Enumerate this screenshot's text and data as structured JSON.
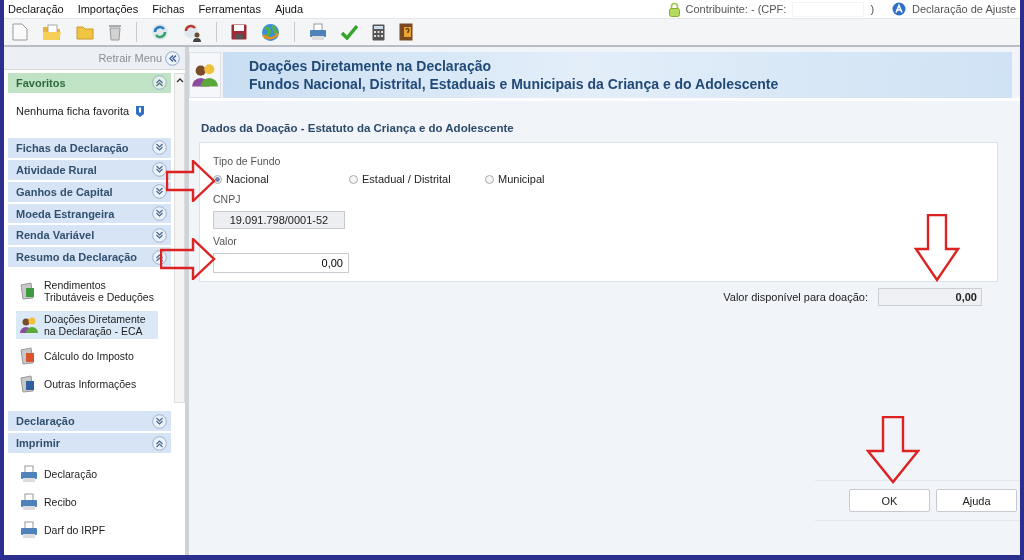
{
  "menu": [
    "Declaração",
    "Importações",
    "Fichas",
    "Ferramentas",
    "Ajuda"
  ],
  "status": {
    "taxpayer": "Contribuinte:  - (CPF:",
    "close_paren": ")",
    "declaration": "Declaração de Ajuste"
  },
  "sidebar": {
    "retract": "Retrair Menu",
    "sections": [
      {
        "title": "Favoritos",
        "kind": "favorites",
        "expanded": true,
        "empty_text": "Nenhuma ficha favorita"
      },
      {
        "title": "Fichas da Declaração",
        "kind": "group",
        "expanded": false
      },
      {
        "title": "Atividade Rural",
        "kind": "group",
        "expanded": false
      },
      {
        "title": "Ganhos de Capital",
        "kind": "group",
        "expanded": false
      },
      {
        "title": "Moeda Estrangeira",
        "kind": "group",
        "expanded": false
      },
      {
        "title": "Renda Variável",
        "kind": "group",
        "expanded": false
      },
      {
        "title": "Resumo da Declaração",
        "kind": "group",
        "expanded": true,
        "items": [
          {
            "label": "Rendimentos Tributáveis e Deduções",
            "kind": "money",
            "selected": false
          },
          {
            "label": "Doações Diretamente na Declaração - ECA",
            "kind": "people",
            "selected": true
          },
          {
            "label": "Cálculo do Imposto",
            "kind": "percent",
            "selected": false
          },
          {
            "label": "Outras Informações",
            "kind": "info",
            "selected": false
          }
        ]
      },
      {
        "title": "Declaração",
        "kind": "group",
        "expanded": false
      },
      {
        "title": "Imprimir",
        "kind": "group",
        "expanded": true,
        "items": [
          {
            "label": "Declaração",
            "kind": "printer",
            "selected": false
          },
          {
            "label": "Recibo",
            "kind": "printer",
            "selected": false
          },
          {
            "label": "Darf do IRPF",
            "kind": "printer",
            "selected": false
          }
        ]
      }
    ]
  },
  "header": {
    "title": "Doações Diretamente na Declaração",
    "subtitle": "Fundos Nacional, Distrital, Estaduais e Municipais da Criança e do Adolescente"
  },
  "form": {
    "title": "Dados da Doação - Estatuto da Criança e do Adolescente",
    "fund_label": "Tipo de Fundo",
    "fund_types": [
      {
        "label": "Nacional",
        "selected": true
      },
      {
        "label": "Estadual / Distrital",
        "selected": false
      },
      {
        "label": "Municipal",
        "selected": false
      }
    ],
    "cnpj_label": "CNPJ",
    "cnpj": "19.091.798/0001-52",
    "value_label": "Valor",
    "value": "0,00",
    "available_label": "Valor disponível para doação:",
    "available": "0,00"
  },
  "buttons": [
    "OK",
    "Ajuda"
  ]
}
